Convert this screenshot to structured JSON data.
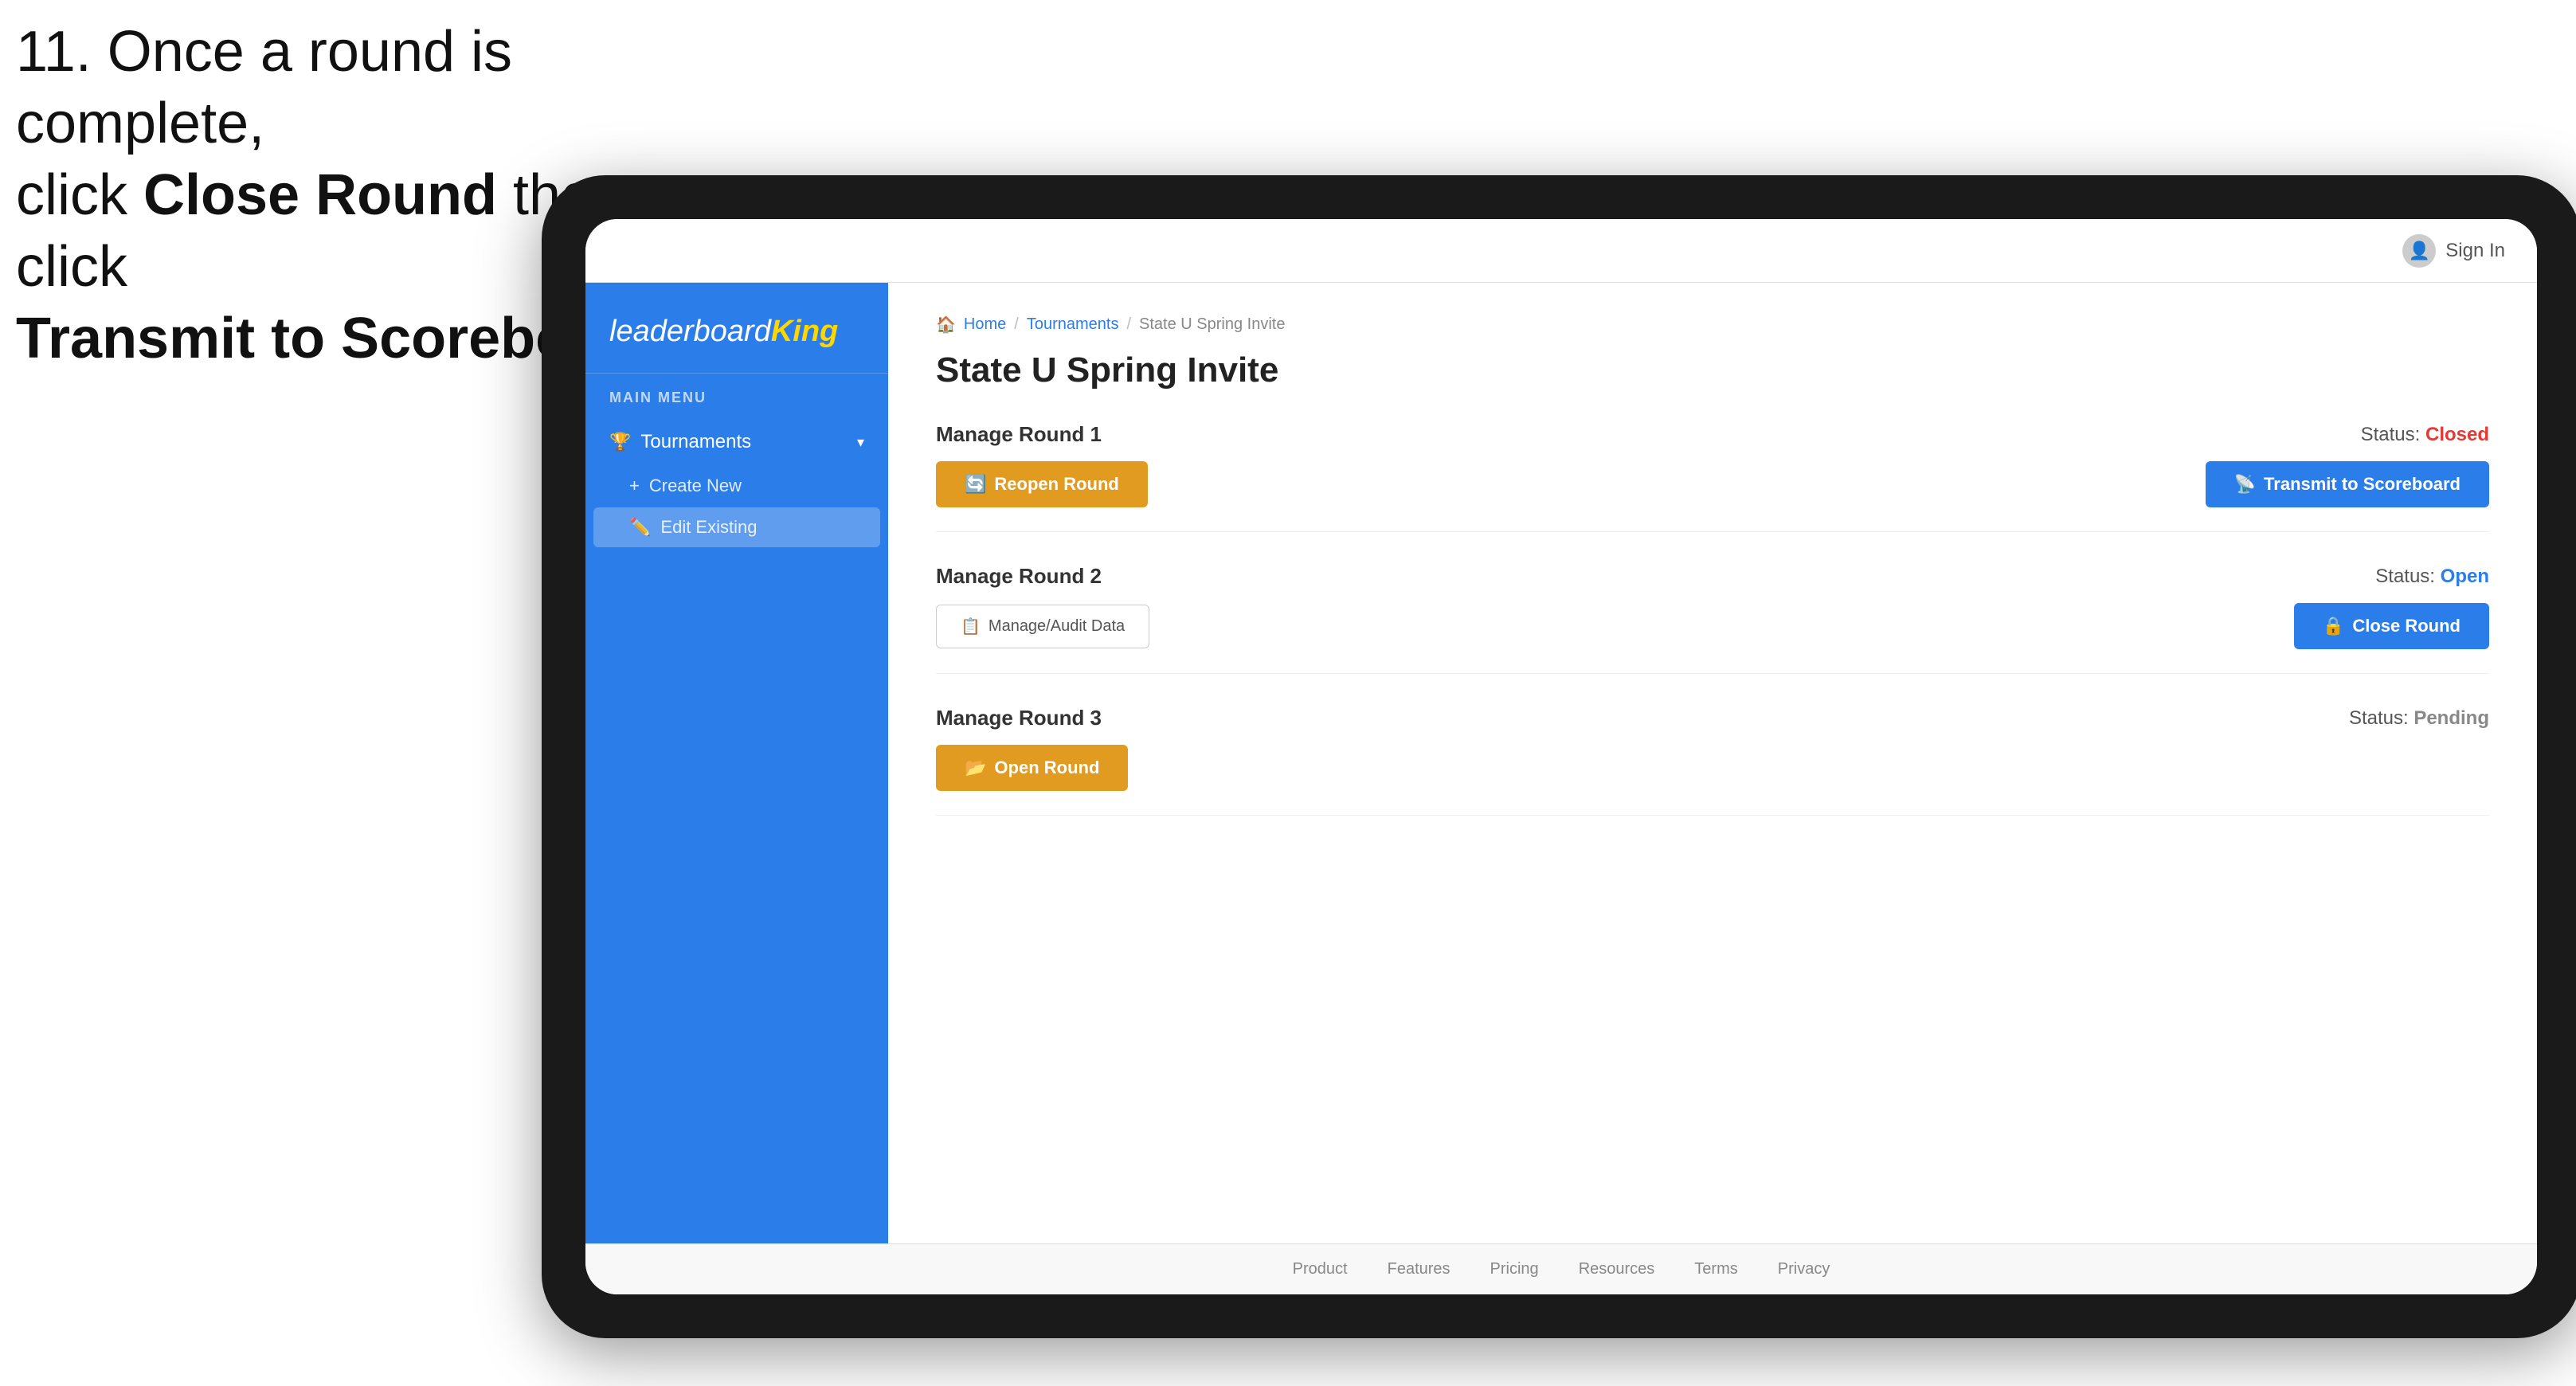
{
  "instruction": {
    "line1": "11. Once a round is complete,",
    "line2_normal": "click ",
    "line2_bold": "Close Round",
    "line2_end": " then click",
    "line3_bold": "Transmit to Scoreboard."
  },
  "tablet": {
    "header": {
      "sign_in_label": "Sign In",
      "avatar_icon": "👤"
    },
    "sidebar": {
      "logo_leaderboard": "leaderboard",
      "logo_king": "King",
      "main_menu_label": "MAIN MENU",
      "items": [
        {
          "id": "tournaments",
          "label": "Tournaments",
          "icon": "🏆",
          "expanded": true
        }
      ],
      "sub_items": [
        {
          "id": "create-new",
          "label": "Create New",
          "icon": "+"
        },
        {
          "id": "edit-existing",
          "label": "Edit Existing",
          "icon": "✏️",
          "selected": true
        }
      ]
    },
    "breadcrumb": {
      "home": "Home",
      "sep1": "/",
      "tournaments": "Tournaments",
      "sep2": "/",
      "current": "State U Spring Invite"
    },
    "page_title": "State U Spring Invite",
    "rounds": [
      {
        "id": "round-1",
        "label": "Manage Round 1",
        "status_label": "Status:",
        "status_value": "Closed",
        "status_class": "status-closed",
        "left_button": {
          "label": "Reopen Round",
          "icon": "🔄",
          "type": "reopen"
        },
        "right_button": {
          "label": "Transmit to Scoreboard",
          "icon": "📡",
          "type": "transmit"
        }
      },
      {
        "id": "round-2",
        "label": "Manage Round 2",
        "status_label": "Status:",
        "status_value": "Open",
        "status_class": "status-open",
        "left_button": {
          "label": "Manage/Audit Data",
          "icon": "📋",
          "type": "audit"
        },
        "right_button": {
          "label": "Close Round",
          "icon": "🔒",
          "type": "close"
        }
      },
      {
        "id": "round-3",
        "label": "Manage Round 3",
        "status_label": "Status:",
        "status_value": "Pending",
        "status_class": "status-pending",
        "left_button": {
          "label": "Open Round",
          "icon": "📂",
          "type": "open"
        },
        "right_button": null
      }
    ],
    "footer": {
      "links": [
        "Product",
        "Features",
        "Pricing",
        "Resources",
        "Terms",
        "Privacy"
      ]
    }
  }
}
